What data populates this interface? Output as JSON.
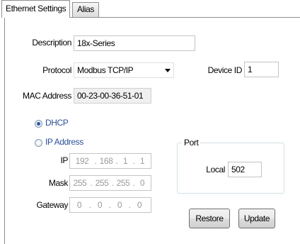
{
  "tabs": [
    {
      "label": "Ethernet Settings",
      "active": true
    },
    {
      "label": "Alias",
      "active": false
    }
  ],
  "form": {
    "description_label": "Description",
    "description_value": "18x-Series",
    "protocol_label": "Protocol",
    "protocol_value": "Modbus TCP/IP",
    "device_id_label": "Device ID",
    "device_id_value": "1",
    "mac_label": "MAC Address",
    "mac_value": "00-23-00-36-51-01"
  },
  "addressing": {
    "dhcp_label": "DHCP",
    "dhcp_selected": true,
    "ip_address_label": "IP Address",
    "ip_address_selected": false,
    "ip_label": "IP",
    "ip_octets": [
      "192",
      "168",
      "1",
      "1"
    ],
    "mask_label": "Mask",
    "mask_octets": [
      "255",
      "255",
      "255",
      "0"
    ],
    "gateway_label": "Gateway",
    "gateway_octets": [
      "0",
      "0",
      "0",
      "0"
    ],
    "separator": "."
  },
  "port": {
    "group_title": "Port",
    "local_label": "Local",
    "local_value": "502"
  },
  "buttons": {
    "restore": "Restore",
    "update": "Update"
  },
  "colors": {
    "accent_blue": "#2a4f96",
    "disabled_text": "#9a9a9a"
  }
}
